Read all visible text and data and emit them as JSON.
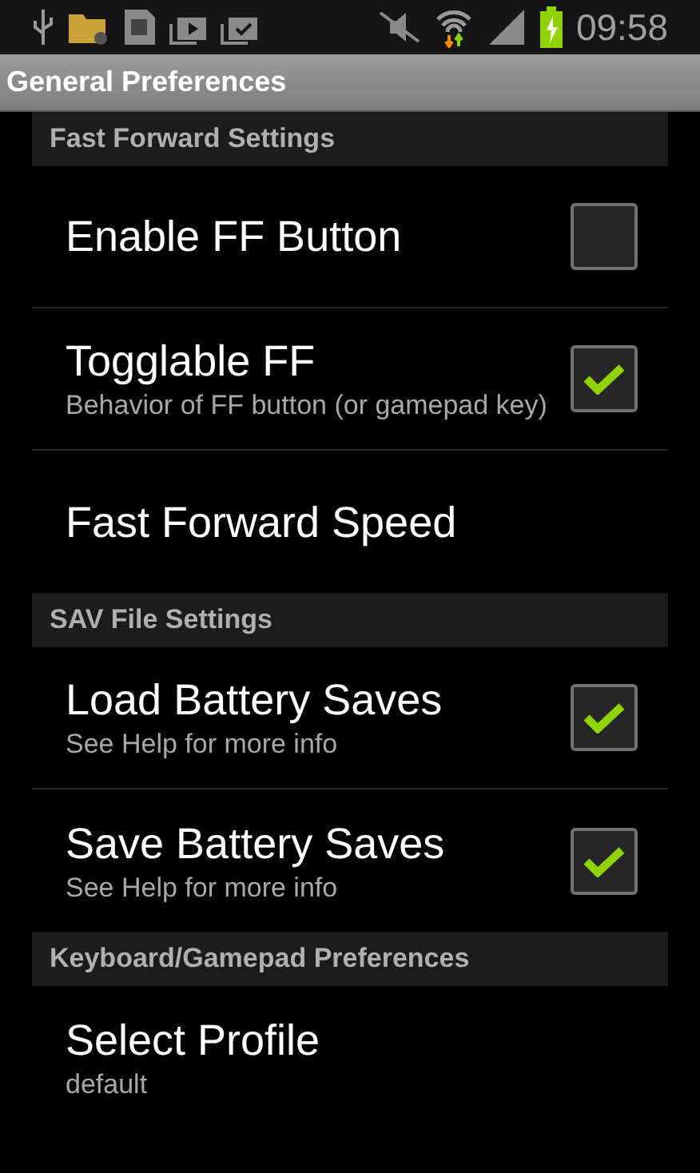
{
  "status_bar": {
    "time": "09:58"
  },
  "window": {
    "title": "General Preferences"
  },
  "sections": [
    {
      "header": "Fast Forward Settings",
      "items": [
        {
          "kind": "checkbox",
          "title": "Enable FF Button",
          "checked": false
        },
        {
          "kind": "checkbox",
          "title": "Togglable FF",
          "summary": "Behavior of FF button (or gamepad key)",
          "checked": true
        },
        {
          "kind": "plain",
          "title": "Fast Forward Speed"
        }
      ]
    },
    {
      "header": "SAV File Settings",
      "items": [
        {
          "kind": "checkbox",
          "title": "Load Battery Saves",
          "summary": "See Help for more info",
          "checked": true
        },
        {
          "kind": "checkbox",
          "title": "Save Battery Saves",
          "summary": "See Help for more info",
          "checked": true
        }
      ]
    },
    {
      "header": "Keyboard/Gamepad Preferences",
      "items": [
        {
          "kind": "plain",
          "title": "Select Profile",
          "summary": "default"
        }
      ]
    }
  ]
}
